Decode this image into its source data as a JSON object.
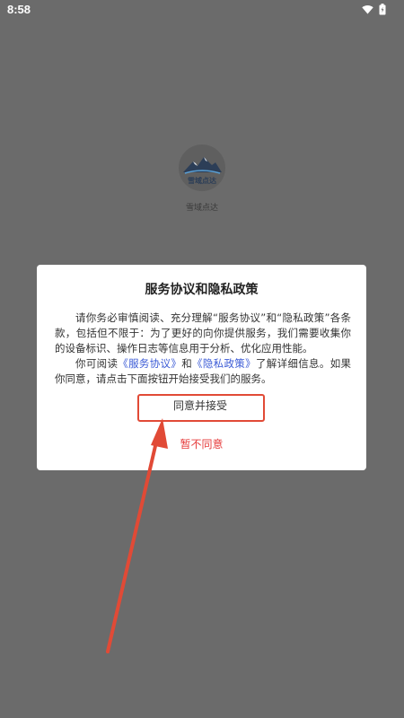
{
  "status_bar": {
    "time": "8:58",
    "icons": [
      "wifi-icon",
      "battery-icon"
    ]
  },
  "splash": {
    "logo_text": "雪域点达",
    "app_name": "雪域点达"
  },
  "dialog": {
    "title": "服务协议和隐私政策",
    "para1": "请你务必审慎阅读、充分理解“服务协议”和“隐私政策”各条款，包括但不限于：为了更好的向你提供服务，我们需要收集你的设备标识、操作日志等信息用于分析、优化应用性能。",
    "para2_prefix": "你可阅读",
    "link_service": "《服务协议》",
    "para2_and": "和",
    "link_privacy": "《隐私政策》",
    "para2_suffix": "了解详细信息。如果你同意，请点击下面按钮开始接受我们的服务。",
    "agree_label": "同意并接受",
    "disagree_label": "暂不同意"
  },
  "colors": {
    "background": "#6b6b6b",
    "dialog_bg": "#ffffff",
    "link": "#3b5bd6",
    "disagree": "#e63b3b",
    "annotation": "#e14a36"
  }
}
